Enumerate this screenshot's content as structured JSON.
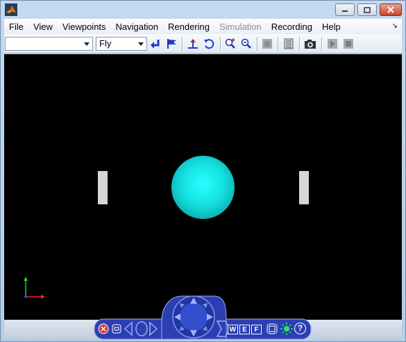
{
  "menu": {
    "items": [
      {
        "label": "File",
        "enabled": true
      },
      {
        "label": "View",
        "enabled": true
      },
      {
        "label": "Viewpoints",
        "enabled": true
      },
      {
        "label": "Navigation",
        "enabled": true
      },
      {
        "label": "Rendering",
        "enabled": true
      },
      {
        "label": "Simulation",
        "enabled": false
      },
      {
        "label": "Recording",
        "enabled": true
      },
      {
        "label": "Help",
        "enabled": true
      }
    ]
  },
  "toolbar": {
    "viewpoint_value": "",
    "navigation_mode": "Fly"
  },
  "scene": {
    "background": "#000000",
    "sphere_color": "#20f5f5",
    "post_color": "#d6d6d6"
  },
  "navpanel": {
    "wire_label": "W",
    "edge_label": "E",
    "fill_label": "F",
    "help_label": "?"
  },
  "colors": {
    "panel_blue": "#2b3fb5",
    "axis_x": "#ff2020",
    "axis_y": "#20d020",
    "axis_z": "#2040ff"
  }
}
